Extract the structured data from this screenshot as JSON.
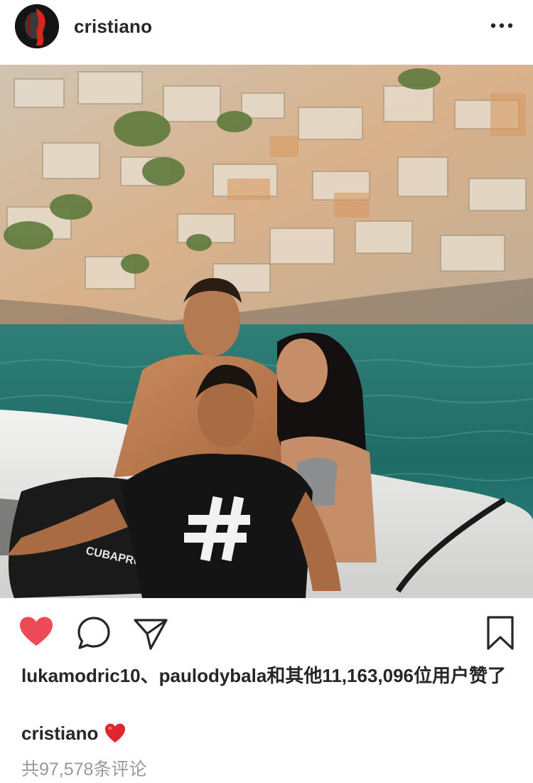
{
  "post": {
    "username": "cristiano",
    "caption_user": "cristiano",
    "caption_emoji_icon": "red-heart-icon",
    "likes_text": "lukamodric10、paulodybala和其他11,163,096位用户赞了",
    "comments_text": "共97,578条评论"
  },
  "icons": {
    "more": "more-options-icon",
    "like": "heart-icon",
    "comment": "comment-icon",
    "share": "paper-plane-icon",
    "save": "bookmark-icon"
  },
  "colors": {
    "like_active": "#ed4956",
    "text": "#262626",
    "muted": "#999999"
  },
  "photo": {
    "brand_text": "CUBAPRO"
  }
}
